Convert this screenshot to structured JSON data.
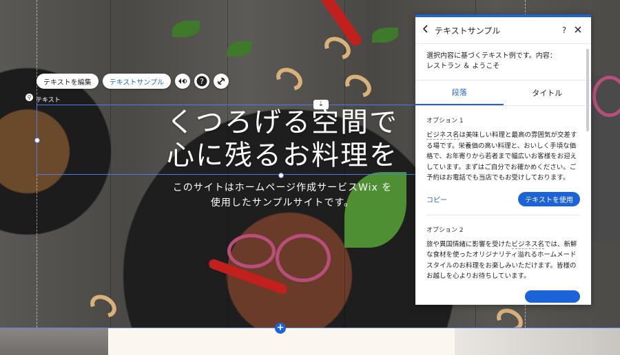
{
  "hero": {
    "title": "くつろげる空間で\n心に残るお料理を",
    "subtitle": "このサイトはホームページ作成サービスWix を\n使用したサンプルサイトです。"
  },
  "selection": {
    "label": "テキスト"
  },
  "toolbar": {
    "edit_text_label": "テキストを編集",
    "text_sample_label": "テキストサンプル"
  },
  "panel": {
    "title": "テキストサンプル",
    "help": "?",
    "intro": "選択内容に基づくテキスト例です。内容：\nレストラン ＆ ようこそ",
    "tabs": [
      "段落",
      "タイトル"
    ],
    "options": [
      {
        "title": "オプション 1",
        "highlight": "ビジネス名",
        "text": "は美味しい料理と最高の雰囲気が交差する場です。栄養価の高い料理と、おいしく手頃な価格で、お年寄りから若者まで幅広いお客様をお迎えしています。まずはご自分でお確かめください。ご予約はお電話でも当店でもお受けしております。",
        "copy_label": "コピー",
        "use_label": "テキストを使用"
      },
      {
        "title": "オプション 2",
        "text_before": "旅や異国情緒に影響を受けた",
        "highlight": "ビジネス名",
        "text": "では、新鮮な食材を使ったオリジナリティ溢れるホームメードスタイルのお料理をお楽しみいただけます。皆様のお越しを心よりお待ちしています。"
      }
    ]
  }
}
